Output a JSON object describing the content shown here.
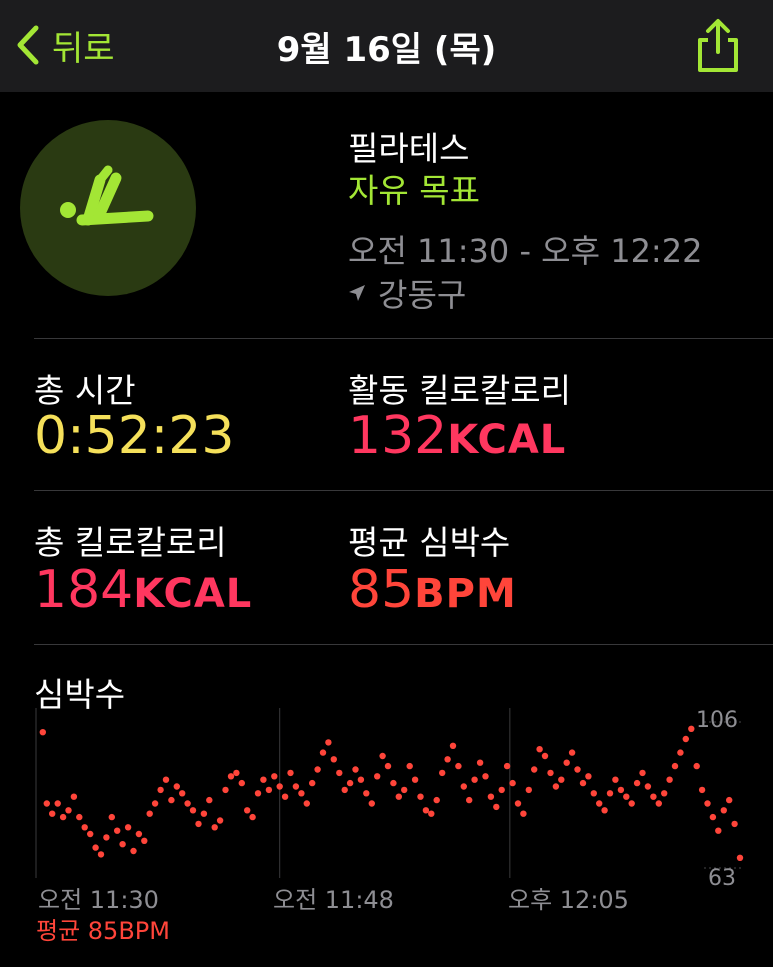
{
  "nav": {
    "back_label": "뒤로",
    "title": "9월 16일 (목)"
  },
  "workout": {
    "icon": "pilates-figure-icon",
    "name": "필라테스",
    "goal": "자유 목표",
    "time_range": "오전 11:30 - 오후 12:22",
    "location": "강동구"
  },
  "metrics": {
    "total_time": {
      "label": "총 시간",
      "value": "0:52:23"
    },
    "active_kcal": {
      "label": "활동 킬로칼로리",
      "value": "132",
      "unit": "KCAL"
    },
    "total_kcal": {
      "label": "총 킬로칼로리",
      "value": "184",
      "unit": "KCAL"
    },
    "avg_hr": {
      "label": "평균 심박수",
      "value": "85",
      "unit": "BPM"
    }
  },
  "heart_rate": {
    "title": "심박수",
    "x_ticks": [
      "오전 11:30",
      "오전 11:48",
      "오후 12:05"
    ],
    "y_max_label": "106",
    "y_min_label": "63",
    "average_label": "평균 85BPM"
  },
  "colors": {
    "accent": "#a3e635",
    "time": "#f5e05a",
    "kcal": "#ff375f",
    "hr": "#ff453a"
  },
  "chart_data": {
    "type": "scatter",
    "xlabel": "",
    "ylabel": "",
    "ylim": [
      63,
      106
    ],
    "x_range_minutes": [
      0,
      52
    ],
    "series": [
      {
        "name": "",
        "values": [
          [
            0.5,
            103
          ],
          [
            0.8,
            82
          ],
          [
            1.2,
            79
          ],
          [
            1.6,
            82
          ],
          [
            2.0,
            78
          ],
          [
            2.4,
            80
          ],
          [
            2.8,
            84
          ],
          [
            3.2,
            78
          ],
          [
            3.6,
            75
          ],
          [
            4.0,
            73
          ],
          [
            4.4,
            69
          ],
          [
            4.8,
            67
          ],
          [
            5.2,
            72
          ],
          [
            5.6,
            78
          ],
          [
            6.0,
            74
          ],
          [
            6.4,
            70
          ],
          [
            6.8,
            75
          ],
          [
            7.2,
            68
          ],
          [
            7.6,
            73
          ],
          [
            8.0,
            71
          ],
          [
            8.4,
            79
          ],
          [
            8.8,
            82
          ],
          [
            9.2,
            86
          ],
          [
            9.6,
            89
          ],
          [
            10.0,
            83
          ],
          [
            10.4,
            87
          ],
          [
            10.8,
            85
          ],
          [
            11.2,
            82
          ],
          [
            11.6,
            80
          ],
          [
            12.0,
            76
          ],
          [
            12.4,
            79
          ],
          [
            12.8,
            83
          ],
          [
            13.2,
            75
          ],
          [
            13.6,
            77
          ],
          [
            14.0,
            86
          ],
          [
            14.4,
            90
          ],
          [
            14.8,
            91
          ],
          [
            15.2,
            88
          ],
          [
            15.6,
            80
          ],
          [
            16.0,
            78
          ],
          [
            16.4,
            85
          ],
          [
            16.8,
            89
          ],
          [
            17.2,
            86
          ],
          [
            17.6,
            90
          ],
          [
            18.0,
            87
          ],
          [
            18.4,
            84
          ],
          [
            18.8,
            91
          ],
          [
            19.2,
            87
          ],
          [
            19.6,
            85
          ],
          [
            20.0,
            82
          ],
          [
            20.4,
            88
          ],
          [
            20.8,
            92
          ],
          [
            21.2,
            97
          ],
          [
            21.6,
            100
          ],
          [
            22.0,
            95
          ],
          [
            22.4,
            91
          ],
          [
            22.8,
            86
          ],
          [
            23.2,
            88
          ],
          [
            23.6,
            92
          ],
          [
            24.0,
            89
          ],
          [
            24.4,
            85
          ],
          [
            24.8,
            82
          ],
          [
            25.2,
            90
          ],
          [
            25.6,
            96
          ],
          [
            26.0,
            93
          ],
          [
            26.4,
            88
          ],
          [
            26.8,
            84
          ],
          [
            27.2,
            86
          ],
          [
            27.6,
            93
          ],
          [
            28.0,
            89
          ],
          [
            28.4,
            84
          ],
          [
            28.8,
            80
          ],
          [
            29.2,
            79
          ],
          [
            29.6,
            83
          ],
          [
            30.0,
            91
          ],
          [
            30.4,
            95
          ],
          [
            30.8,
            99
          ],
          [
            31.2,
            93
          ],
          [
            31.6,
            87
          ],
          [
            32.0,
            83
          ],
          [
            32.4,
            89
          ],
          [
            32.8,
            94
          ],
          [
            33.2,
            90
          ],
          [
            33.6,
            84
          ],
          [
            34.0,
            81
          ],
          [
            34.4,
            86
          ],
          [
            34.8,
            93
          ],
          [
            35.2,
            88
          ],
          [
            35.6,
            82
          ],
          [
            36.0,
            79
          ],
          [
            36.4,
            86
          ],
          [
            36.8,
            92
          ],
          [
            37.2,
            98
          ],
          [
            37.6,
            96
          ],
          [
            38.0,
            91
          ],
          [
            38.4,
            87
          ],
          [
            38.8,
            89
          ],
          [
            39.2,
            94
          ],
          [
            39.6,
            97
          ],
          [
            40.0,
            92
          ],
          [
            40.4,
            88
          ],
          [
            40.8,
            90
          ],
          [
            41.2,
            85
          ],
          [
            41.6,
            82
          ],
          [
            42.0,
            80
          ],
          [
            42.4,
            85
          ],
          [
            42.8,
            89
          ],
          [
            43.2,
            86
          ],
          [
            43.6,
            84
          ],
          [
            44.0,
            82
          ],
          [
            44.4,
            88
          ],
          [
            44.8,
            91
          ],
          [
            45.2,
            87
          ],
          [
            45.6,
            84
          ],
          [
            46.0,
            82
          ],
          [
            46.4,
            85
          ],
          [
            46.8,
            89
          ],
          [
            47.2,
            93
          ],
          [
            47.6,
            97
          ],
          [
            48.0,
            101
          ],
          [
            48.4,
            104
          ],
          [
            48.8,
            93
          ],
          [
            49.2,
            86
          ],
          [
            49.6,
            82
          ],
          [
            50.0,
            78
          ],
          [
            50.4,
            74
          ],
          [
            50.8,
            80
          ],
          [
            51.2,
            83
          ],
          [
            51.6,
            76
          ],
          [
            52.0,
            66
          ]
        ]
      }
    ]
  }
}
